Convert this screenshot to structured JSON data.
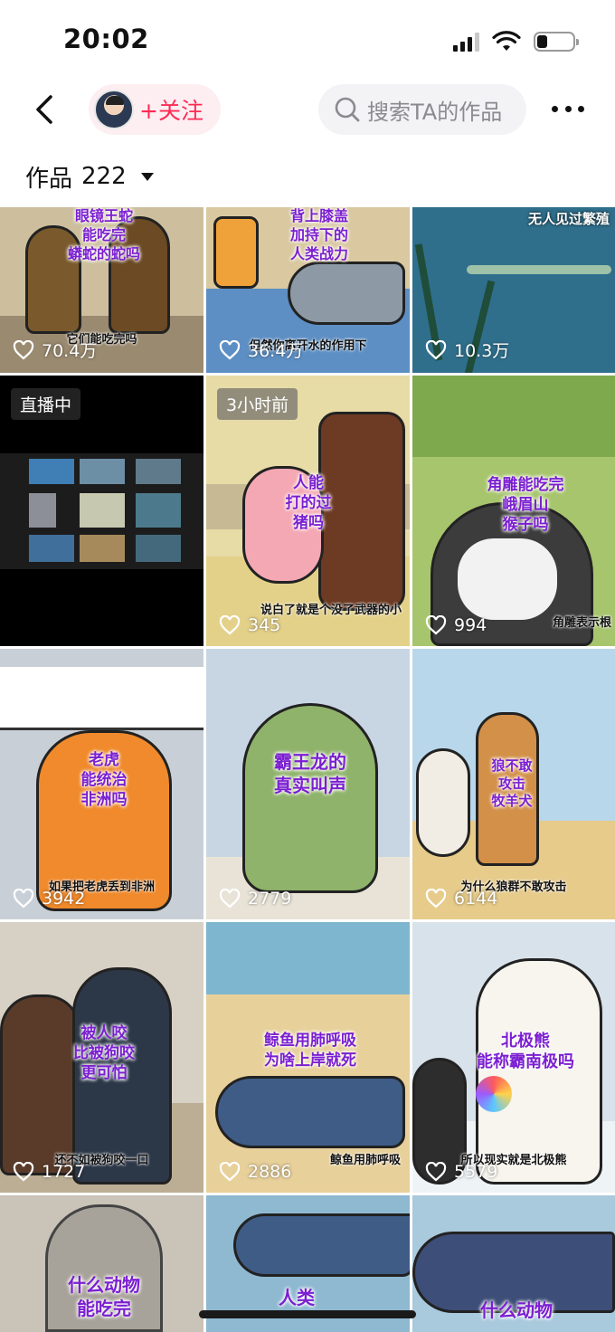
{
  "status_bar": {
    "time": "20:02"
  },
  "header": {
    "follow_label": "+关注",
    "search_placeholder": "搜索TA的作品"
  },
  "works": {
    "label": "作品",
    "count": "222"
  },
  "tiles": [
    {
      "caption": "它们能吃完吗",
      "bubble": "眼镜王蛇\n能吃完\n蟒蛇的蛇吗",
      "likes": "70.4万"
    },
    {
      "caption": "但然你离开水的作用下",
      "bubble": "背上膝盖\n加持下的\n人类战力",
      "likes": "36.4万"
    },
    {
      "caption": "无人见过繁殖",
      "bubble": "",
      "likes": "10.3万"
    },
    {
      "tag": "直播中",
      "caption": "",
      "bubble": "",
      "likes": ""
    },
    {
      "tag": "3小时前",
      "caption": "说白了就是个没了武器的小",
      "bubble": "人能\n打的过\n猪吗",
      "likes": "345"
    },
    {
      "caption": "角雕表示根",
      "bubble": "角雕能吃完\n峨眉山\n猴子吗",
      "likes": "994"
    },
    {
      "caption": "如果把老虎丢到非洲",
      "bubble": "老虎\n能统治\n非洲吗",
      "likes": "3942"
    },
    {
      "caption": "",
      "bubble": "霸王龙的\n真实叫声",
      "likes": "2779"
    },
    {
      "caption": "为什么狼群不敢攻击",
      "bubble": "狼不敢\n攻击\n牧羊犬",
      "likes": "6144"
    },
    {
      "caption": "还不如被狗咬一口",
      "bubble": "被人咬\n比被狗咬\n更可怕",
      "likes": "1727"
    },
    {
      "caption": "鲸鱼用肺呼吸",
      "bubble": "鲸鱼用肺呼吸\n为啥上岸就死",
      "likes": "2886"
    },
    {
      "caption": "所以现实就是北极熊",
      "bubble": "北极熊\n能称霸南极吗",
      "likes": "5579"
    },
    {
      "caption": "",
      "bubble": "什么动物\n能吃完",
      "likes": ""
    },
    {
      "caption": "",
      "bubble": "人类",
      "likes": ""
    },
    {
      "caption": "",
      "bubble": "什么动物",
      "likes": ""
    }
  ]
}
